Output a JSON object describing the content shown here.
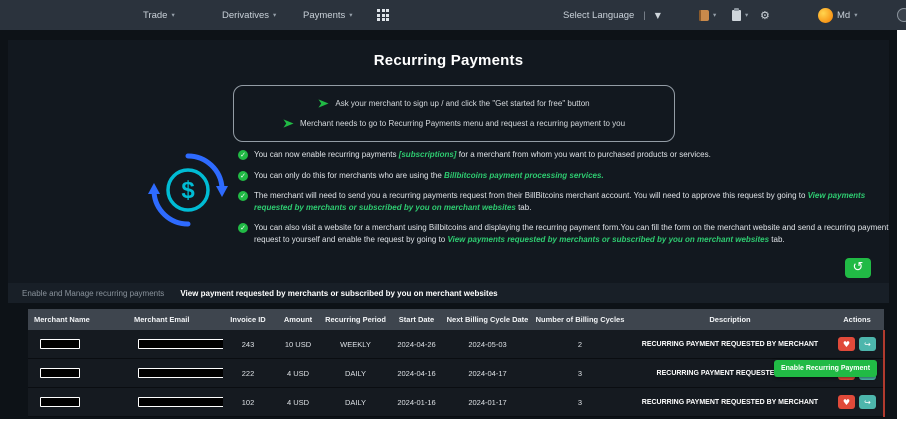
{
  "colors": {
    "accent_green": "#21ba45",
    "link_green": "#2ecc71",
    "danger_red": "#e04a3a",
    "action_teal": "#4db6ac",
    "arrow_blue": "#2e6bff",
    "dollar_cyan": "#00bcd4"
  },
  "icons": {
    "caret_small": "▾",
    "caret_down": "▼",
    "divider": "|",
    "gear": "⚙",
    "check": "✓",
    "history": "↺",
    "heart": "♥",
    "share": "↪",
    "dollar": "$"
  },
  "navbar": {
    "menus": [
      {
        "label": "Trade"
      },
      {
        "label": "Derivatives"
      },
      {
        "label": "Payments"
      }
    ],
    "language_label": "Select Language",
    "username": "Md"
  },
  "content": {
    "title": "Recurring Payments",
    "instructions": [
      "Ask your merchant to sign up / and click the \"Get started for free\" button",
      "Merchant needs to go to Recurring Payments menu and request a recurring payment to you"
    ],
    "bullets": [
      {
        "parts": [
          "You can now enable recurring payments ",
          "[subscriptions]",
          " for a merchant from whom you want to purchased products or services."
        ]
      },
      {
        "parts": [
          "You can only do this for merchants who are using the ",
          "Billbitcoins payment processing services."
        ]
      },
      {
        "parts": [
          "The merchant will need to send you a recurring payments request from their BillBitcoins merchant account. You will need to approve this request by going to ",
          "View payments requested by merchants or subscribed by you on merchant websites",
          " tab."
        ]
      },
      {
        "parts": [
          "You can also visit a website for a merchant using Billbitcoins and displaying the recurring payment form.You can fill the form on the merchant website and send a recurring payment request to yourself and enable the request by going to ",
          "View payments requested by merchants or subscribed by you on merchant websites",
          " tab."
        ]
      }
    ]
  },
  "tabs": [
    {
      "label": "Enable and Manage recurring payments",
      "active": false
    },
    {
      "label": "View payment requested by merchants or subscribed by you on merchant websites",
      "active": true
    }
  ],
  "table": {
    "headers": [
      "Merchant Name",
      "Merchant Email",
      "Invoice ID",
      "Amount",
      "Recurring Period",
      "Start Date",
      "Next Billing Cycle Date",
      "Number of Billing Cycles",
      "Description",
      "Actions"
    ],
    "rows": [
      {
        "invoice_id": "243",
        "amount": "10 USD",
        "recurring_period": "WEEKLY",
        "start_date": "2024-04-26",
        "next_billing_cycle_date": "2024-05-03",
        "number_of_billing_cycles": "2",
        "description": "RECURRING PAYMENT REQUESTED BY MERCHANT"
      },
      {
        "invoice_id": "222",
        "amount": "4 USD",
        "recurring_period": "DAILY",
        "start_date": "2024-04-16",
        "next_billing_cycle_date": "2024-04-17",
        "number_of_billing_cycles": "3",
        "description": "RECURRING PAYMENT REQUESTED BY ME"
      },
      {
        "invoice_id": "102",
        "amount": "4 USD",
        "recurring_period": "DAILY",
        "start_date": "2024-01-16",
        "next_billing_cycle_date": "2024-01-17",
        "number_of_billing_cycles": "3",
        "description": "RECURRING PAYMENT REQUESTED BY MERCHANT"
      }
    ]
  },
  "tooltip": {
    "label": "Enable Recurring Payment"
  }
}
